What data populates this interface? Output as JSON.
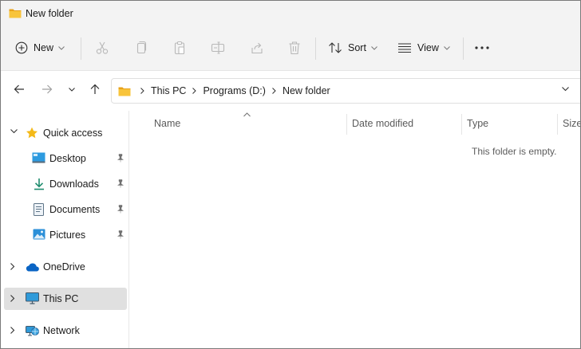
{
  "window": {
    "title": "New folder"
  },
  "toolbar": {
    "new_label": "New",
    "sort_label": "Sort",
    "view_label": "View",
    "more_label": "..."
  },
  "address": {
    "crumbs": [
      "This PC",
      "Programs (D:)",
      "New folder"
    ]
  },
  "sidebar": {
    "quick_access": "Quick access",
    "items": [
      {
        "label": "Desktop",
        "icon": "desktop-icon"
      },
      {
        "label": "Downloads",
        "icon": "downloads-icon"
      },
      {
        "label": "Documents",
        "icon": "documents-icon"
      },
      {
        "label": "Pictures",
        "icon": "pictures-icon"
      }
    ],
    "onedrive": "OneDrive",
    "this_pc": "This PC",
    "network": "Network"
  },
  "content": {
    "columns": [
      "Name",
      "Date modified",
      "Type",
      "Size"
    ],
    "empty_message": "This folder is empty."
  },
  "colors": {
    "folder_yellow": "#f8c43b",
    "accent_blue": "#0067c0",
    "selected_bg": "#e0e0e0"
  }
}
